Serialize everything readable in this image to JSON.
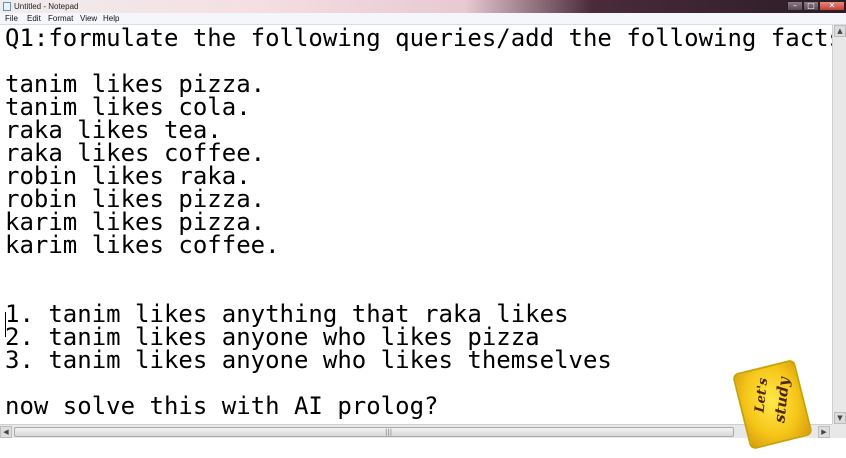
{
  "window": {
    "title": "Untitled - Notepad"
  },
  "menu": {
    "items": [
      "File",
      "Edit",
      "Format",
      "View",
      "Help"
    ]
  },
  "editor": {
    "lines": [
      "Q1:formulate the following queries/add the following facts?",
      "",
      "tanim likes pizza.",
      "tanim likes cola.",
      "raka likes tea.",
      "raka likes coffee.",
      "robin likes raka.",
      "robin likes pizza.",
      "karim likes pizza.",
      "karim likes coffee.",
      "",
      "",
      "1. tanim likes anything that raka likes",
      "2. tanim likes anyone who likes pizza",
      "3. tanim likes anyone who likes themselves",
      "",
      "now solve this with AI prolog?"
    ]
  },
  "watermark": {
    "line1": "Let's",
    "line2": "study"
  },
  "icons": {
    "app": "notepad-icon",
    "minimize": "minimize-icon",
    "maximize": "maximize-icon",
    "close": "close-icon",
    "scroll_up": "scroll-up-icon",
    "scroll_down": "scroll-down-icon",
    "scroll_left": "scroll-left-icon",
    "scroll_right": "scroll-right-icon"
  },
  "colors": {
    "logo": "#f6c619",
    "close_button": "#c2412f"
  }
}
